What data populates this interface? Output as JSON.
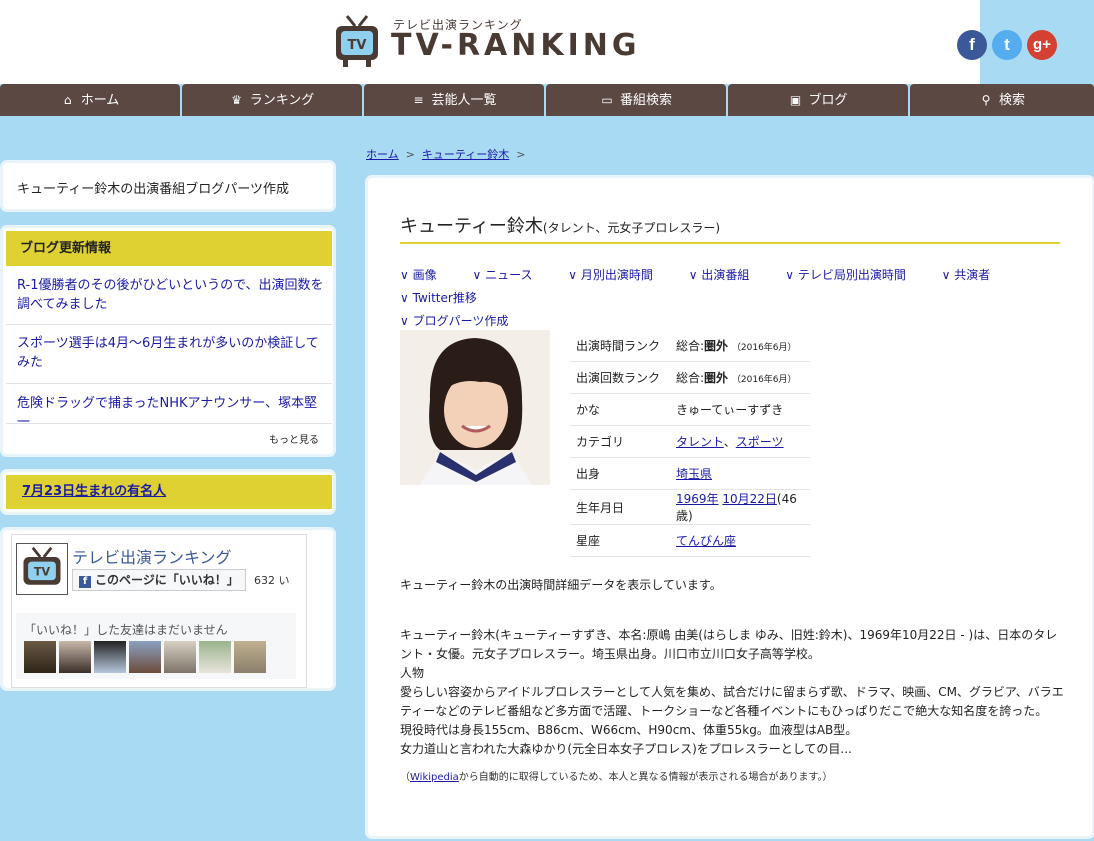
{
  "site": {
    "logo_sub": "テレビ出演ランキング",
    "logo_main": "TV-RANKING",
    "logo_icon": "tv-icon",
    "social": [
      {
        "icon": "facebook-icon",
        "glyph": "f"
      },
      {
        "icon": "twitter-icon",
        "glyph": "t"
      },
      {
        "icon": "googleplus-icon",
        "glyph": "g+"
      }
    ]
  },
  "nav": [
    {
      "label": "ホーム",
      "icon": "home-icon",
      "glyph": "⌂"
    },
    {
      "label": "ランキング",
      "icon": "crown-icon",
      "glyph": "♛"
    },
    {
      "label": "芸能人一覧",
      "icon": "list-icon",
      "glyph": "≡"
    },
    {
      "label": "番組検索",
      "icon": "monitor-icon",
      "glyph": "▭"
    },
    {
      "label": "ブログ",
      "icon": "picture-icon",
      "glyph": "▣"
    },
    {
      "label": "検索",
      "icon": "search-icon",
      "glyph": "⚲"
    }
  ],
  "breadcrumb": {
    "home": "ホーム",
    "current": "キューティー鈴木",
    "sep": ">"
  },
  "sidebar": {
    "blogparts_title": "キューティー鈴木の出演番組ブログパーツ作成",
    "blog_heading": "ブログ更新情報",
    "blog_items": [
      "R-1優勝者のその後がひどいというので、出演回数を調べてみました",
      "スポーツ選手は4月～6月生まれが多いのか検証してみた",
      "危険ドラッグで捕まったNHKアナウンサー、塚本堅一"
    ],
    "more": "もっと見る",
    "birthday_link": "7月23日生まれの有名人",
    "fb": {
      "title": "テレビ出演ランキング",
      "like_label": "このページに「いいね！」",
      "count": "632 い",
      "friends_text": "「いいね！」した友達はまだいません"
    }
  },
  "profile": {
    "name": "キューティー鈴木",
    "subtitle": "(タレント、元女子プロレスラー)",
    "tabs": [
      "画像",
      "ニュース",
      "月別出演時間",
      "出演番組",
      "テレビ局別出演時間",
      "共演者",
      "Twitter推移",
      "ブログパーツ作成"
    ],
    "rows": {
      "time_rank": {
        "key": "出演時間ランク",
        "prefix": "総合:",
        "value": "圏外",
        "period": "（2016年6月）"
      },
      "count_rank": {
        "key": "出演回数ランク",
        "prefix": "総合:",
        "value": "圏外",
        "period": "（2016年6月）"
      },
      "kana": {
        "key": "かな",
        "value": "きゅーてぃーすずき"
      },
      "category": {
        "key": "カテゴリ",
        "v1": "タレント",
        "sep": "、",
        "v2": "スポーツ"
      },
      "origin": {
        "key": "出身",
        "value": "埼玉県"
      },
      "birth": {
        "key": "生年月日",
        "year": "1969年",
        "day": "10月22日",
        "age": "(46歳)"
      },
      "zodiac": {
        "key": "星座",
        "value": "てんびん座"
      }
    },
    "desc_short": "キューティー鈴木の出演時間詳細データを表示しています。",
    "desc_long": [
      "キューティー鈴木(キューティーすずき、本名:原嶋 由美(はらしま ゆみ、旧姓:鈴木)、1969年10月22日 - )は、日本のタレント・女優。元女子プロレスラー。埼玉県出身。川口市立川口女子高等学校。",
      "人物",
      "愛らしい容姿からアイドルプロレスラーとして人気を集め、試合だけに留まらず歌、ドラマ、映画、CM、グラビア、バラエティーなどのテレビ番組など多方面で活躍、トークショーなど各種イベントにもひっぱりだこで絶大な知名度を誇った。",
      "現役時代は身長155cm、B86cm、W66cm、H90cm、体重55kg。血液型はAB型。",
      "女力道山と言われた大森ゆかり(元全日本女子プロレス)をプロレスラーとしての目..."
    ],
    "note_prefix": "（",
    "note_link": "Wikipedia",
    "note_suffix": "から自動的に取得しているため、本人と異なる情報が表示される場合があります。）"
  },
  "colors": {
    "nav_bg": "#5b4843",
    "page_bg": "#a9daf4",
    "accent_yellow": "#dfd132",
    "link": "#1a1aa6"
  }
}
